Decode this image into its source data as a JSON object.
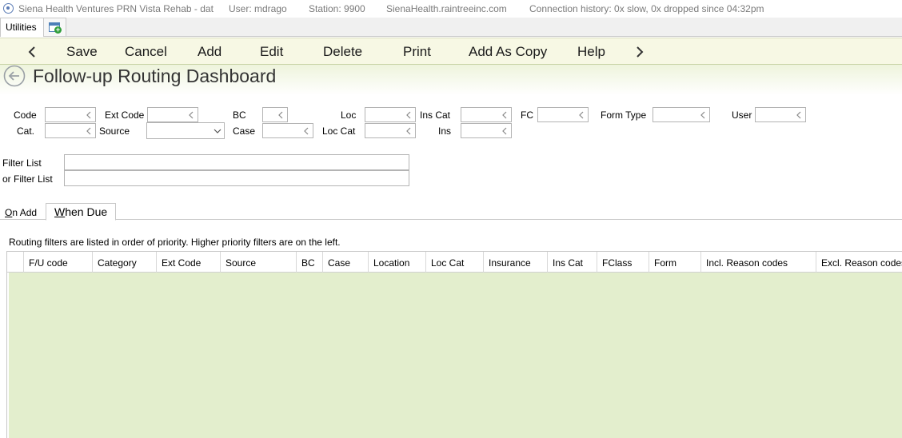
{
  "titlebar": {
    "app": "Siena Health Ventures PRN Vista Rehab - dat",
    "user": "User: mdrago",
    "station": "Station: 9900",
    "host": "SienaHealth.raintreeinc.com",
    "connection": "Connection history: 0x slow, 0x dropped since 04:32pm"
  },
  "tabs": {
    "utilities": "Utilities",
    "new_window_icon": "new-window-icon"
  },
  "toolbar": {
    "prev_icon": "chevron-left-icon",
    "save": "Save",
    "cancel": "Cancel",
    "add": "Add",
    "edit": "Edit",
    "delete": "Delete",
    "print": "Print",
    "add_as_copy": "Add As Copy",
    "help": "Help",
    "next_icon": "chevron-right-icon"
  },
  "header": {
    "title": "Follow-up Routing Dashboard",
    "back_icon": "back-arrow-icon"
  },
  "filters": {
    "code": "Code",
    "ext_code": "Ext Code",
    "bc": "BC",
    "loc": "Loc",
    "ins_cat": "Ins Cat",
    "fc": "FC",
    "form_type": "Form Type",
    "user": "User",
    "cat": "Cat.",
    "source": "Source",
    "case": "Case",
    "loc_cat": "Loc Cat",
    "ins": "Ins",
    "filter_list": "Filter List",
    "or_filter_list": "or Filter List",
    "values": {
      "code": "",
      "ext_code": "",
      "bc": "",
      "loc": "",
      "ins_cat": "",
      "fc": "",
      "form_type": "",
      "user": "",
      "cat": "",
      "source": "",
      "case": "",
      "loc_cat": "",
      "ins": "",
      "filter_list": "",
      "or_filter_list": ""
    }
  },
  "subtabs": {
    "on_add_first": "O",
    "on_add_rest": "n Add",
    "when_due_first": "W",
    "when_due_rest": "hen Due"
  },
  "hint": "Routing filters are listed in order of priority. Higher priority filters are on the left.",
  "grid": {
    "columns": [
      "F/U code",
      "Category",
      "Ext Code",
      "Source",
      "BC",
      "Case",
      "Location",
      "Loc Cat",
      "Insurance",
      "Ins Cat",
      "FClass",
      "Form",
      "Incl. Reason codes",
      "Excl. Reason codes"
    ],
    "rows": []
  },
  "colors": {
    "toolbar_bg": "#f7f8e4",
    "grid_body_bg": "#e3eecd",
    "header_gradient": "#eef4dc"
  }
}
